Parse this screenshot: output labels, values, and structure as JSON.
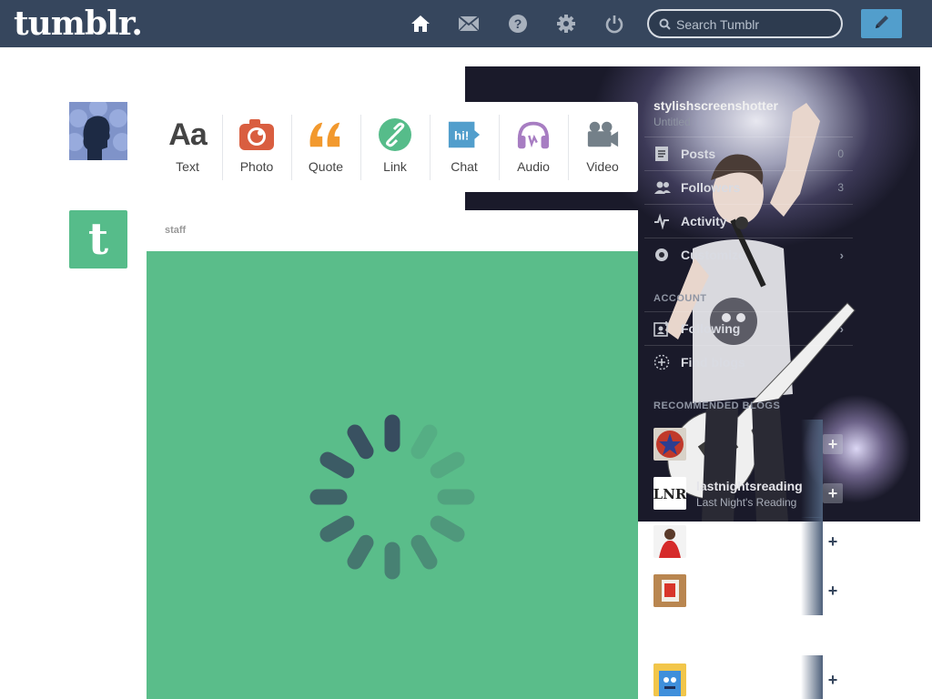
{
  "app": {
    "logo": "tumblr."
  },
  "nav": {
    "icons": [
      "home-icon",
      "inbox-icon",
      "help-icon",
      "settings-icon",
      "logout-icon"
    ],
    "search_placeholder": "Search Tumblr",
    "compose_icon": "pencil-icon"
  },
  "colors": {
    "topbar": "#36465d",
    "accent": "#529ecc",
    "staff": "#56bc8a",
    "post": "#5abd8a"
  },
  "post_types": [
    {
      "label": "Text",
      "icon": "text-icon",
      "glyph": "Aa",
      "color": "#444444"
    },
    {
      "label": "Photo",
      "icon": "camera-icon",
      "color": "#d95e40"
    },
    {
      "label": "Quote",
      "icon": "quote-icon",
      "glyph": "““",
      "color": "#f2992e"
    },
    {
      "label": "Link",
      "icon": "link-icon",
      "color": "#56bc8a"
    },
    {
      "label": "Chat",
      "icon": "chat-icon",
      "glyph": "hi!",
      "color": "#529ecc"
    },
    {
      "label": "Audio",
      "icon": "headphones-icon",
      "color": "#a77dc2"
    },
    {
      "label": "Video",
      "icon": "video-camera-icon",
      "color": "#748089"
    }
  ],
  "post": {
    "author": "staff"
  },
  "sidebar": {
    "blog_name": "stylishscreenshotter",
    "blog_subtitle": "Untitled",
    "rows": [
      {
        "label": "Posts",
        "count": "0",
        "icon": "posts-icon"
      },
      {
        "label": "Followers",
        "count": "3",
        "icon": "followers-icon"
      },
      {
        "label": "Activity",
        "count": "",
        "icon": "activity-icon"
      },
      {
        "label": "Customize",
        "count": "",
        "icon": "customize-icon",
        "chevron": "›"
      }
    ],
    "account_heading": "ACCOUNT",
    "account_rows": [
      {
        "label": "Following",
        "icon": "following-icon",
        "chevron": "›"
      },
      {
        "label": "Find blogs",
        "icon": "find-blogs-icon"
      }
    ],
    "recommended_heading": "RECOMMENDED BLOGS",
    "recommended": [
      {
        "title": "",
        "subtitle": "",
        "avatar": "avatar-star",
        "follow": "+"
      },
      {
        "title": "lastnightsreading",
        "subtitle": "Last Night's Reading",
        "avatar": "avatar-lnr",
        "follow": "+"
      },
      {
        "title": "",
        "subtitle": "",
        "avatar": "avatar-red",
        "follow": "+"
      },
      {
        "title": "",
        "subtitle": "",
        "avatar": "avatar-frame",
        "follow": "+"
      },
      {
        "title": "",
        "subtitle": "",
        "avatar": "avatar-blue",
        "follow": "+"
      }
    ]
  }
}
